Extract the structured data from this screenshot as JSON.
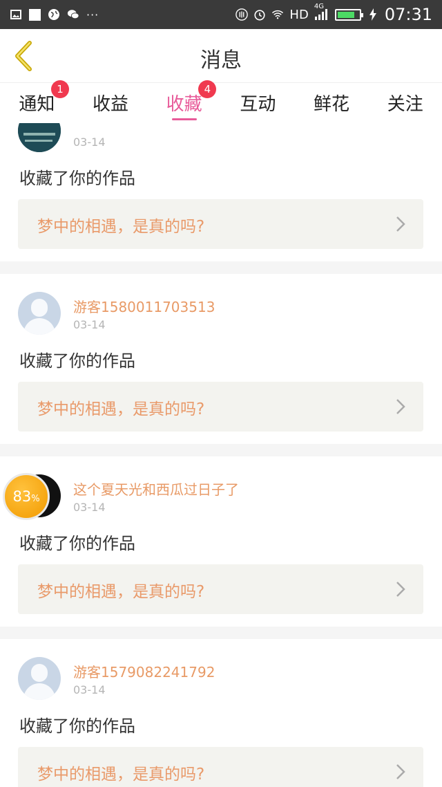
{
  "status_bar": {
    "hd_label": "HD",
    "network_label": "4G",
    "time": "07:31",
    "battery_level": 0.8,
    "icons": [
      "image-icon",
      "square-icon",
      "globe-icon",
      "wechat-icon",
      "more-dots-icon",
      "nfc-icon",
      "alarm-icon",
      "wifi-icon",
      "signal-icon",
      "battery-icon",
      "charging-icon"
    ],
    "more_dots": "···"
  },
  "header": {
    "title": "消息",
    "back_icon": "chevron-left-icon"
  },
  "tabs": [
    {
      "label": "通知",
      "badge": "1"
    },
    {
      "label": "收益"
    },
    {
      "label": "收藏",
      "badge": "4",
      "active": true
    },
    {
      "label": "互动"
    },
    {
      "label": "鲜花"
    },
    {
      "label": "关注"
    }
  ],
  "colors": {
    "accent_pink": "#e85a99",
    "badge_red": "#f0394f",
    "username_orange": "#e89a66",
    "work_title_orange": "#e99a6a"
  },
  "feed": {
    "items": [
      {
        "user": "",
        "date": "03-14",
        "action": "收藏了你的作品",
        "work_title": "梦中的相遇，是真的吗?",
        "avatar": "book-cover"
      },
      {
        "user": "游客1580011703513",
        "date": "03-14",
        "action": "收藏了你的作品",
        "work_title": "梦中的相遇，是真的吗?",
        "avatar": "default"
      },
      {
        "user": "这个夏天光和西瓜过日子了",
        "date": "03-14",
        "action": "收藏了你的作品",
        "work_title": "梦中的相遇，是真的吗?",
        "avatar": "dark"
      },
      {
        "user": "游客1579082241792",
        "date": "03-14",
        "action": "收藏了你的作品",
        "work_title": "梦中的相遇，是真的吗?",
        "avatar": "default"
      }
    ]
  },
  "floating_badge": {
    "value": "83",
    "unit": "%"
  }
}
